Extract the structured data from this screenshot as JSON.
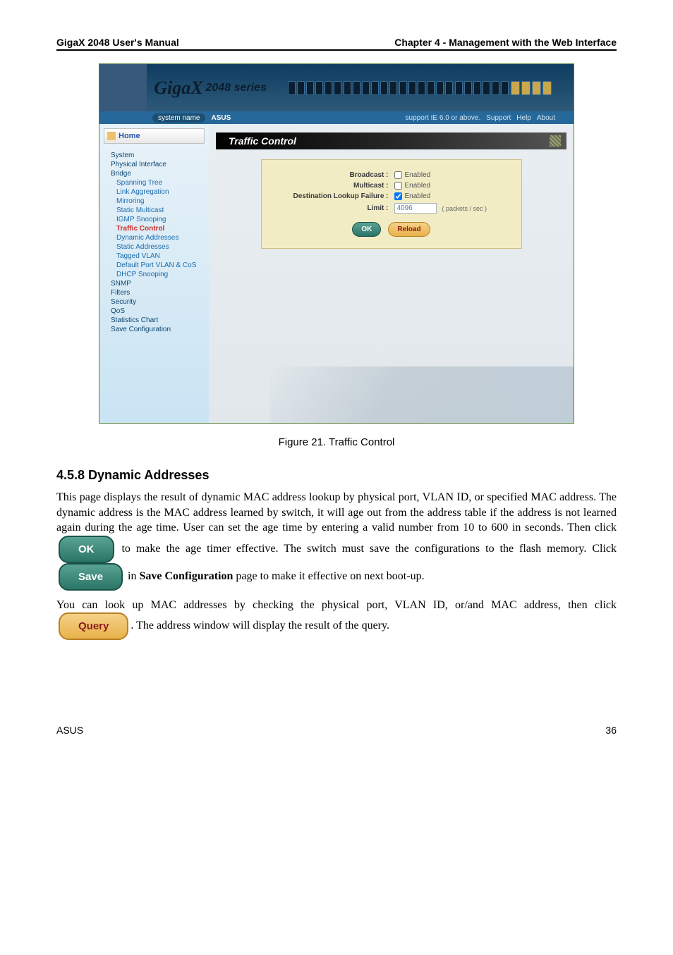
{
  "header": {
    "left": "GigaX 2048 User's Manual",
    "right": "Chapter 4 - Management with the Web Interface"
  },
  "screenshot": {
    "brand": "GigaX",
    "series": "2048 series",
    "sysname_label": "system name",
    "sysname": "ASUS",
    "support": "support IE 6.0 or above.",
    "links": {
      "support": "Support",
      "help": "Help",
      "about": "About"
    },
    "home": "Home",
    "nav_system": "System",
    "nav_phys": "Physical Interface",
    "nav_bridge": "Bridge",
    "nav_span": "Spanning Tree",
    "nav_link": "Link Aggregation",
    "nav_mirror": "Mirroring",
    "nav_smc": "Static Multicast",
    "nav_igmp": "IGMP Snooping",
    "nav_traffic": "Traffic Control",
    "nav_dyn": "Dynamic Addresses",
    "nav_static": "Static Addresses",
    "nav_vlan": "Tagged VLAN",
    "nav_defport": "Default Port VLAN & CoS",
    "nav_dhcp": "DHCP Snooping",
    "nav_snmp": "SNMP",
    "nav_filters": "Filters",
    "nav_sec": "Security",
    "nav_qos": "QoS",
    "nav_stats": "Statistics Chart",
    "nav_save": "Save Configuration",
    "title": "Traffic Control",
    "form": {
      "bcast": {
        "lbl": "Broadcast :",
        "val": "Enabled"
      },
      "mcast": {
        "lbl": "Multicast :",
        "val": "Enabled"
      },
      "dlf": {
        "lbl": "Destination Lookup Failure :",
        "val": "Enabled"
      },
      "limit": {
        "lbl": "Limit :",
        "val": "4096",
        "hint": "( packets / sec )"
      }
    },
    "btnOK": "OK",
    "btnReload": "Reload"
  },
  "figcap": "Figure 21. Traffic Control",
  "sec1": {
    "title": "4.5.8 Dynamic Addresses",
    "p1a": "This page displays the result of dynamic MAC address lookup by physical port, VLAN ID, or specified MAC address. The dynamic address is the MAC address learned by switch, it will age out from the address table if the address is not learned again during the age time. User can set the age time by entering a valid number from 10 to 600 in seconds. Then click ",
    "ok": "OK",
    "p1b": " to make the age timer effective. The switch must save the configurations to the flash memory. Click ",
    "save": "Save",
    "p1c": " in ",
    "savecfg": "Save Configuration",
    "p1d": " page to make it effective on next boot-up.",
    "p2a": "You can look up MAC addresses by checking the physical port, VLAN ID, or/and MAC address, then click ",
    "query": "Query",
    "p2b": ". The address window will display the result of the query."
  },
  "chart_data": {
    "type": "table",
    "title": "Traffic Control form state (as shown in screenshot)",
    "fields": [
      {
        "name": "Broadcast",
        "control": "checkbox",
        "checked": false,
        "label": "Enabled"
      },
      {
        "name": "Multicast",
        "control": "checkbox",
        "checked": false,
        "label": "Enabled"
      },
      {
        "name": "Destination Lookup Failure",
        "control": "checkbox",
        "checked": true,
        "label": "Enabled"
      },
      {
        "name": "Limit",
        "control": "text",
        "value": 4096,
        "unit": "packets / sec"
      }
    ]
  },
  "footer": {
    "brand": "ASUS",
    "page": "36"
  }
}
